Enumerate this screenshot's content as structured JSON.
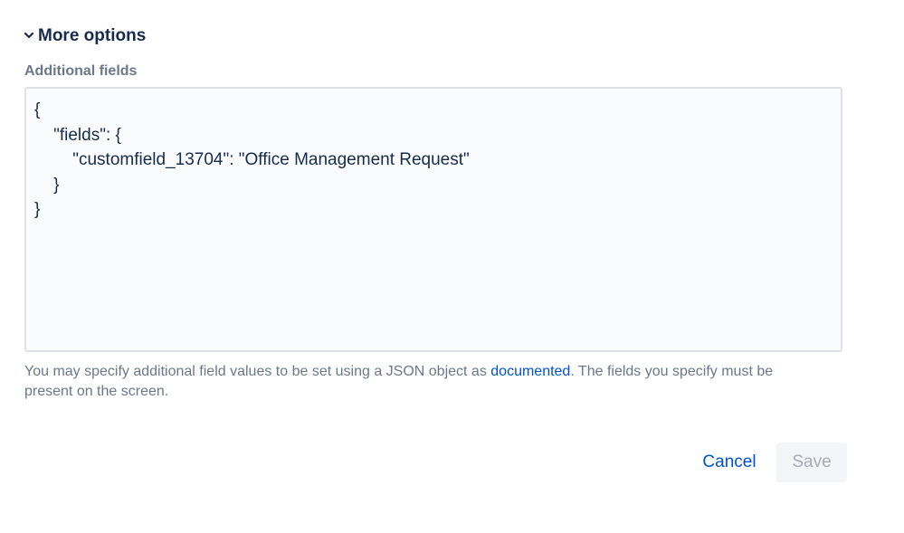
{
  "more_options": {
    "label": "More options",
    "icon": "chevron-down-icon"
  },
  "additional_fields": {
    "label": "Additional fields",
    "value": "{\n    \"fields\": {\n        \"customfield_13704\": \"Office Management Request\"\n    }\n}"
  },
  "help": {
    "text_before": "You may specify additional field values to be set using a JSON object as ",
    "link_text": "documented",
    "text_after": ". The fields you specify must be present on the screen."
  },
  "actions": {
    "cancel_label": "Cancel",
    "save_label": "Save",
    "save_disabled": true
  },
  "colors": {
    "link": "#0052cc",
    "heading": "#172b4d",
    "muted": "#6b778c",
    "disabled_text": "#a5adba"
  }
}
